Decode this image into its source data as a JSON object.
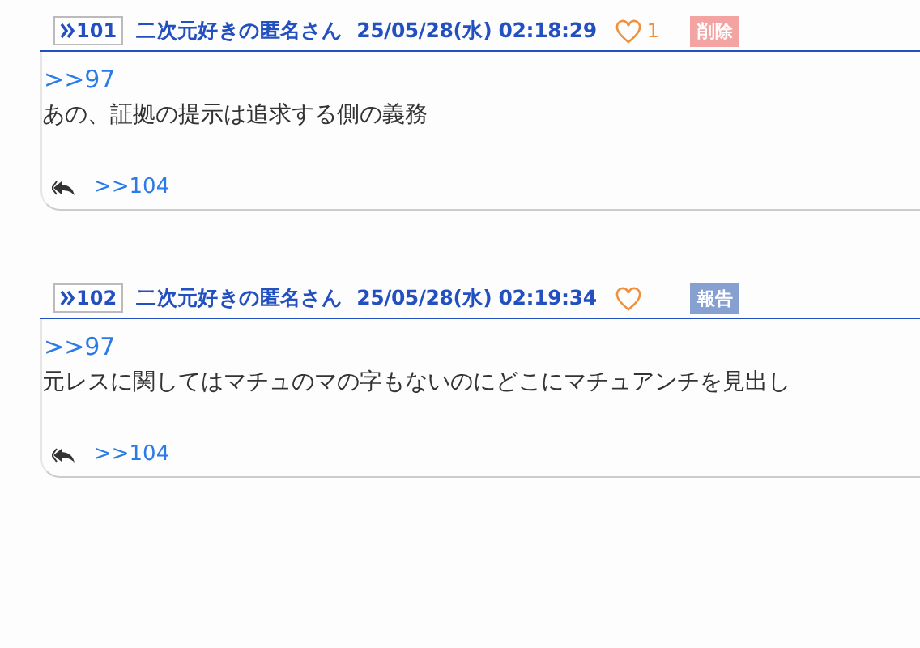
{
  "posts": [
    {
      "number": "101",
      "name": "二次元好きの匿名さん",
      "date": "25/05/28(水) 02:18:29",
      "likes": "1",
      "action": {
        "kind": "delete",
        "label": "削除"
      },
      "anchor": ">>97",
      "text": "あの、証拠の提示は追求する側の義務",
      "replies": [
        ">>104"
      ]
    },
    {
      "number": "102",
      "name": "二次元好きの匿名さん",
      "date": "25/05/28(水) 02:19:34",
      "action": {
        "kind": "report",
        "label": "報告"
      },
      "anchor": ">>97",
      "text": "元レスに関してはマチュのマの字もないのにどこにマチュアンチを見出し",
      "replies": [
        ">>104"
      ]
    }
  ]
}
